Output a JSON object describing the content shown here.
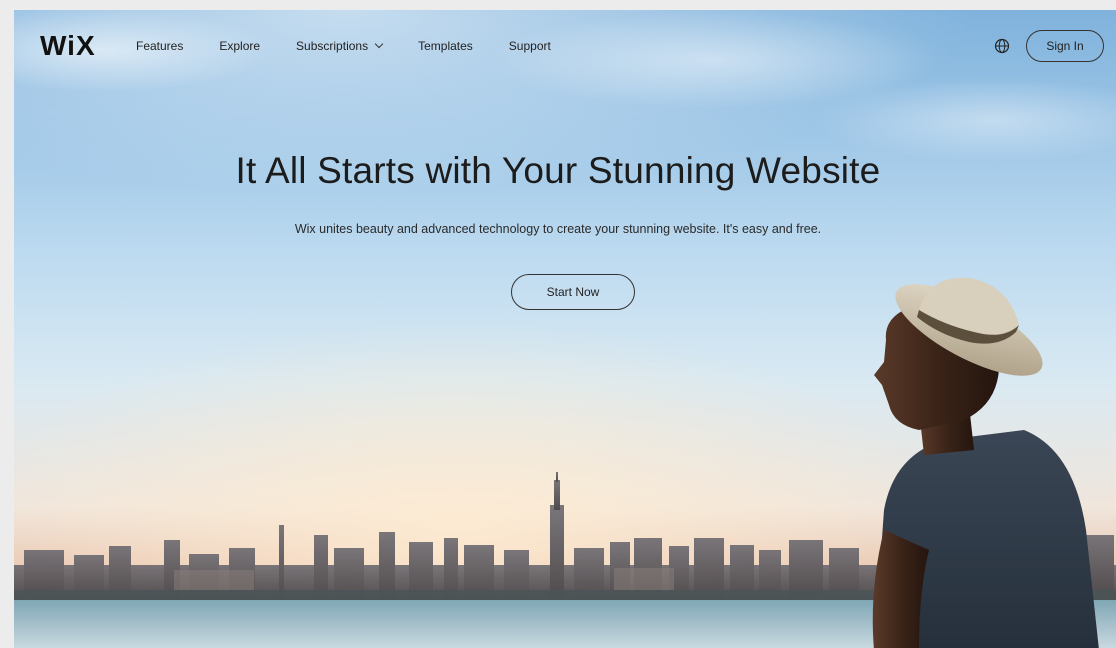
{
  "nav": {
    "logo": "WiX",
    "links": [
      {
        "label": "Features"
      },
      {
        "label": "Explore"
      },
      {
        "label": "Subscriptions",
        "has_dropdown": true
      },
      {
        "label": "Templates"
      },
      {
        "label": "Support"
      }
    ],
    "language_icon": "globe-icon",
    "sign_in_label": "Sign In"
  },
  "hero": {
    "title": "It All Starts with Your Stunning Website",
    "subtitle": "Wix unites beauty and advanced technology to create your stunning website. It's easy and free.",
    "cta_label": "Start Now"
  },
  "background": {
    "sky_top": "#7fb2dc",
    "sky_horizon": "#f0e6dc",
    "water": "#8fb0bd"
  }
}
